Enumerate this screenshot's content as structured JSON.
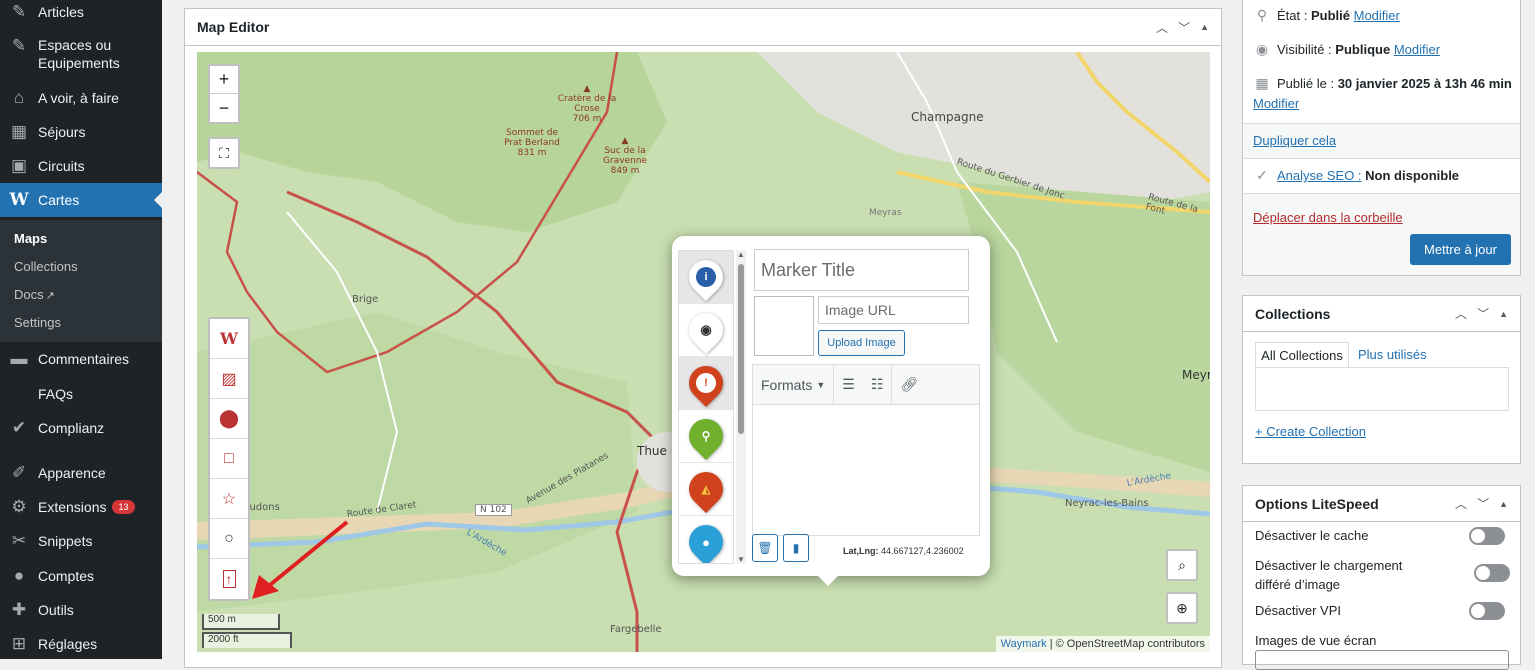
{
  "sidebar": {
    "items": [
      {
        "label": "Articles",
        "icon": "pin-icon"
      },
      {
        "label": "Espaces ou Equipements",
        "icon": "pin-icon"
      },
      {
        "label": "A voir, à faire",
        "icon": "bank-icon"
      },
      {
        "label": "Séjours",
        "icon": "calendar-icon"
      },
      {
        "label": "Circuits",
        "icon": "bus-icon"
      },
      {
        "label": "Cartes",
        "icon": "waymark-icon"
      },
      {
        "label": "Commentaires",
        "icon": "comment-icon"
      },
      {
        "label": "FAQs",
        "icon": "none"
      },
      {
        "label": "Complianz",
        "icon": "check-icon"
      },
      {
        "label": "Apparence",
        "icon": "brush-icon"
      },
      {
        "label": "Extensions",
        "icon": "plugin-icon",
        "badge": "13"
      },
      {
        "label": "Snippets",
        "icon": "scissors-icon"
      },
      {
        "label": "Comptes",
        "icon": "user-icon"
      },
      {
        "label": "Outils",
        "icon": "wrench-icon"
      },
      {
        "label": "Réglages",
        "icon": "settings-icon"
      }
    ],
    "submenu": [
      "Maps",
      "Collections",
      "Docs",
      "Settings"
    ]
  },
  "editor": {
    "title": "Map Editor",
    "map": {
      "labels": {
        "champagne": "Champagne",
        "brige": "Brige",
        "meyras": "Meyras",
        "route_gerbier": "Route du Gerbier de Jonc",
        "route_fonts": "Route de la Font",
        "route_claret": "Route de Claret",
        "avenue_platanes": "Avenue des Platanes",
        "n102": "N 102",
        "chaudons": "haudons",
        "neyrac": "Neyrac-les-Bains",
        "ardeche": "L'Ardèche",
        "ardeche2": "L'Ardèche",
        "fargebelle": "Fargebelle",
        "thueyts": "Thue",
        "meyr": "Meyr"
      },
      "peaks": [
        {
          "name": "Cratère de la Crose",
          "ele": "706 m"
        },
        {
          "name": "Sommet de Prat Berland",
          "ele": "831 m"
        },
        {
          "name": "Suc de la Gravenne",
          "ele": "849 m"
        }
      ],
      "scale_metric": "500 m",
      "scale_imperial": "2000 ft",
      "attribution_link": "Waymark",
      "attribution_rest": " | © OpenStreetMap contributors",
      "colors": {
        "route": "#c8524a",
        "forest": "#b9d8a0",
        "river": "#9fc7e6"
      }
    },
    "popup": {
      "marker_title_placeholder": "Marker Title",
      "image_url_placeholder": "Image URL",
      "upload_label": "Upload Image",
      "formats_label": "Formats",
      "latlng_label": "Lat,Lng:",
      "latlng_value": "44.667127,4.236002",
      "markers": [
        {
          "icon": "info-icon",
          "glyph": "i",
          "color": "#ffffff",
          "inner": "#2a5ea8"
        },
        {
          "icon": "camera-icon",
          "glyph": "◉",
          "color": "#ffffff",
          "inner": "#333333"
        },
        {
          "icon": "alert-icon",
          "glyph": "!",
          "color": "#d0421b",
          "inner": "#ffffff"
        },
        {
          "icon": "bike-icon",
          "glyph": "⚲",
          "color": "#70b02c",
          "inner": "#70b02c"
        },
        {
          "icon": "pizza-icon",
          "glyph": "◭",
          "color": "#d0421b",
          "inner": "#d0421b"
        },
        {
          "icon": "water-drop-icon",
          "glyph": "●",
          "color": "#2aa0d8",
          "inner": "#2aa0d8"
        }
      ]
    }
  },
  "publish": {
    "status_label": "État : ",
    "status_value": "Publié",
    "status_link": "Modifier",
    "visibility_label": "Visibilité : ",
    "visibility_value": "Publique",
    "visibility_link": "Modifier",
    "published_label": "Publié le : ",
    "published_value": "30 janvier 2025 à 13h 46 min",
    "published_link": "Modifier",
    "duplicate_link": "Dupliquer cela",
    "seo_link": "Analyse SEO :",
    "seo_value": " Non disponible",
    "trash_link": "Déplacer dans la corbeille",
    "update_button": "Mettre à jour"
  },
  "collections": {
    "title": "Collections",
    "tab_all": "All Collections",
    "tab_used": "Plus utilisés",
    "create_link": "+ Create Collection"
  },
  "litespeed": {
    "title": "Options LiteSpeed",
    "opt1": "Désactiver le cache",
    "opt2": "Désactiver le chargement différé d’image",
    "opt3": "Désactiver VPI",
    "opt4": "Images de vue écran"
  }
}
